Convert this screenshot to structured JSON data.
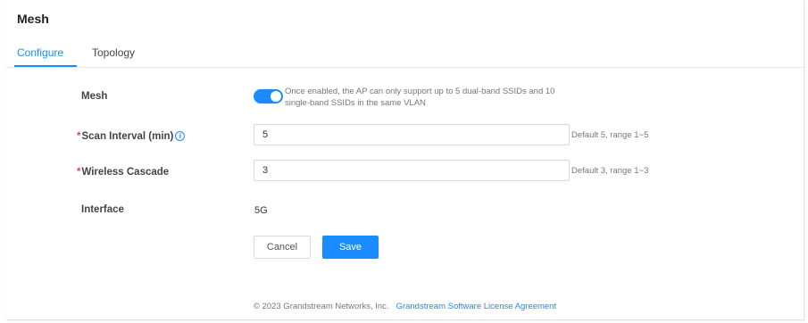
{
  "page": {
    "title": "Mesh"
  },
  "tabs": [
    {
      "label": "Configure",
      "active": true
    },
    {
      "label": "Topology",
      "active": false
    }
  ],
  "form": {
    "mesh": {
      "label": "Mesh",
      "enabled": true,
      "description_line1": "Once enabled, the AP can only support up to 5 dual-band SSIDs and 10",
      "description_line2": "single-band SSIDs in the same VLAN"
    },
    "scan_interval": {
      "required_mark": "*",
      "label": "Scan Interval (min)",
      "info_icon": "i",
      "value": "5",
      "hint": "Default 5, range 1~5"
    },
    "wireless_cascade": {
      "required_mark": "*",
      "label": "Wireless Cascade",
      "value": "3",
      "hint": "Default 3, range 1~3"
    },
    "interface": {
      "label": "Interface",
      "value": "5G"
    }
  },
  "buttons": {
    "cancel": "Cancel",
    "save": "Save"
  },
  "footer": {
    "copyright": "© 2023 Grandstream Networks, Inc.",
    "link": "Grandstream Software License Agreement"
  },
  "colors": {
    "accent": "#1a8cff",
    "required": "#e5484d"
  }
}
